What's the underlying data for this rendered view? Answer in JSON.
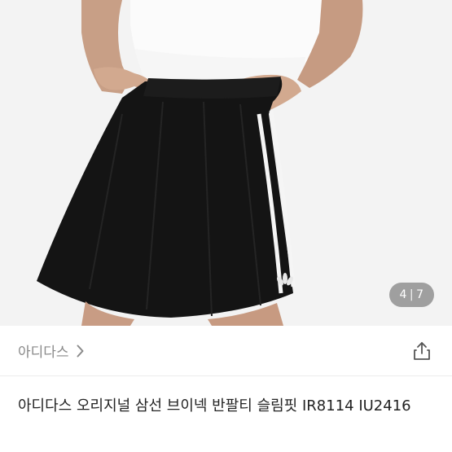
{
  "gallery": {
    "current": "4",
    "separator": "|",
    "total": "7"
  },
  "brand": {
    "name": "아디다스",
    "icon": "chevron-right-icon"
  },
  "actions": {
    "share_icon": "share-icon"
  },
  "product": {
    "title": "아디다스 오리지널 삼선 브이넥 반팔티 슬림핏 IR8114 IU2416"
  }
}
